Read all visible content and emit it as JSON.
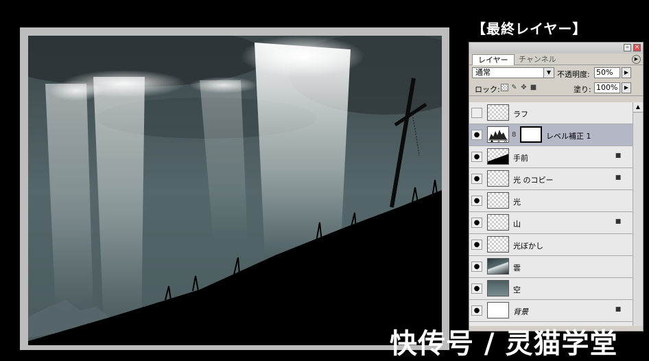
{
  "heading": "【最終レイヤー】",
  "palette": {
    "tabs": [
      "レイヤー",
      "チャンネル"
    ],
    "blend_mode": "通常",
    "opacity_label": "不透明度:",
    "opacity_value": "50%",
    "lock_label": "ロック:",
    "fill_label": "塗り:",
    "fill_value": "100%",
    "layers": [
      {
        "name": "ラフ",
        "visible": false,
        "locked": false
      },
      {
        "name": "レベル補正 1",
        "visible": true,
        "locked": false,
        "selected": true,
        "adjustment": true
      },
      {
        "name": "手前",
        "visible": true,
        "locked": true
      },
      {
        "name": "光 のコピー",
        "visible": true,
        "locked": true
      },
      {
        "name": "光",
        "visible": true,
        "locked": false
      },
      {
        "name": "山",
        "visible": true,
        "locked": true
      },
      {
        "name": "光ぼかし",
        "visible": true,
        "locked": false
      },
      {
        "name": "雲",
        "visible": true,
        "locked": false
      },
      {
        "name": "空",
        "visible": true,
        "locked": false
      },
      {
        "name": "背景",
        "visible": true,
        "locked": true
      }
    ]
  },
  "watermark": "快传号 / 灵猫学堂",
  "icons": {
    "eye": "eye-icon",
    "lock": "lock-icon",
    "chain": "chain-icon"
  }
}
